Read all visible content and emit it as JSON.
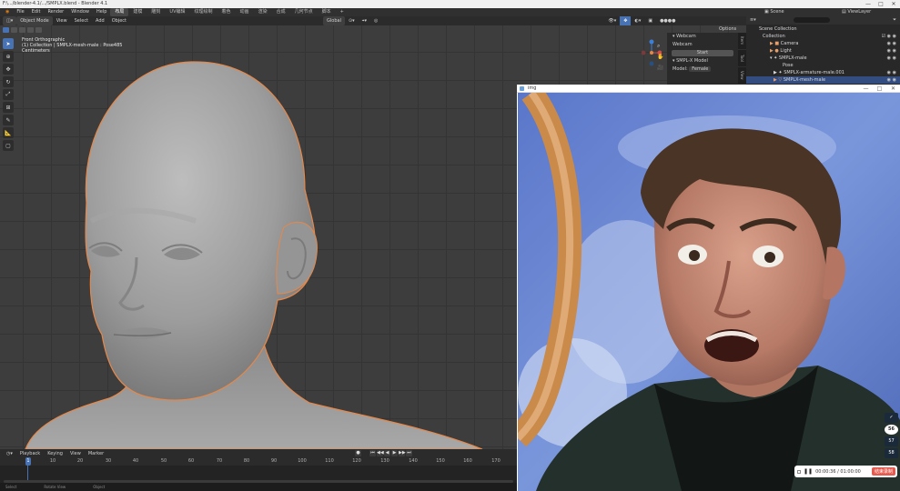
{
  "window": {
    "title": "F:\\.../blender-4.1/.../SMPLX.blend - Blender 4.1",
    "controls": [
      "—",
      "□",
      "✕"
    ]
  },
  "menubar": {
    "menus": [
      "File",
      "Edit",
      "Render",
      "Window",
      "Help"
    ],
    "tabs": [
      "布局",
      "建模",
      "雕刻",
      "UV编辑",
      "纹理绘制",
      "着色",
      "动画",
      "渲染",
      "合成",
      "几何节点",
      "脚本"
    ],
    "active_tab": 0,
    "scene": "Scene",
    "view_layer": "ViewLayer",
    "search_placeholder": ""
  },
  "viewport": {
    "editor_type": "Object Mode",
    "menus": [
      "View",
      "Select",
      "Add",
      "Object"
    ],
    "transform": "Global",
    "overlay_lines": [
      "Front Orthographic",
      "(1) Collection | SMPLX-mesh-male : Pose485",
      "Centimeters"
    ],
    "options_label": "Options"
  },
  "toolbar": {
    "tools": [
      "select-box",
      "cursor",
      "move",
      "rotate",
      "scale",
      "transform",
      "annotate",
      "measure",
      "add-cube"
    ]
  },
  "npanel": {
    "webcam_header": "Webcam",
    "webcam_label": "Webcam",
    "start_button": "Start",
    "smplx_header": "SMPL-X Model",
    "model_label": "Model:",
    "model_value": "Female",
    "tabs": [
      "Item",
      "Tool",
      "View"
    ]
  },
  "outliner": {
    "header": "Scene Collection",
    "rows": [
      {
        "label": "Scene Collection",
        "indent": 0,
        "selected": false
      },
      {
        "label": "Collection",
        "indent": 1,
        "selected": false
      },
      {
        "label": "Camera",
        "indent": 2,
        "selected": false
      },
      {
        "label": "Light",
        "indent": 2,
        "selected": false
      },
      {
        "label": "SMPLX-male",
        "indent": 2,
        "selected": false
      },
      {
        "label": "Pose",
        "indent": 3,
        "selected": false
      },
      {
        "label": "SMPLX-armature-male.001",
        "indent": 3,
        "selected": false
      },
      {
        "label": "SMPLX-mesh-male",
        "indent": 3,
        "selected": true
      }
    ]
  },
  "timeline": {
    "menus": [
      "Playback",
      "Keying",
      "View",
      "Marker"
    ],
    "current_frame": "1",
    "ticks": [
      "1",
      "10",
      "20",
      "30",
      "40",
      "50",
      "60",
      "70",
      "80",
      "90",
      "100",
      "110",
      "120",
      "130",
      "140",
      "150",
      "160",
      "170"
    ],
    "controls": [
      "⏮",
      "◀◀",
      "◀",
      "▶",
      "▶▶",
      "⏭"
    ]
  },
  "statusbar": {
    "items": [
      "Select",
      "Rotate View",
      "Object"
    ]
  },
  "image_window": {
    "title": "img",
    "controls": [
      "—",
      "□",
      "✕"
    ],
    "time": "00:00:36 / 01:00:00",
    "record_label": "结束录制",
    "side_buttons": [
      "✓",
      "56",
      "57",
      "58"
    ]
  },
  "colors": {
    "accent": "#4772b3",
    "viewport_bg": "#3d3d3d",
    "selection_outline": "#e5884a",
    "record": "#e55a4e"
  }
}
